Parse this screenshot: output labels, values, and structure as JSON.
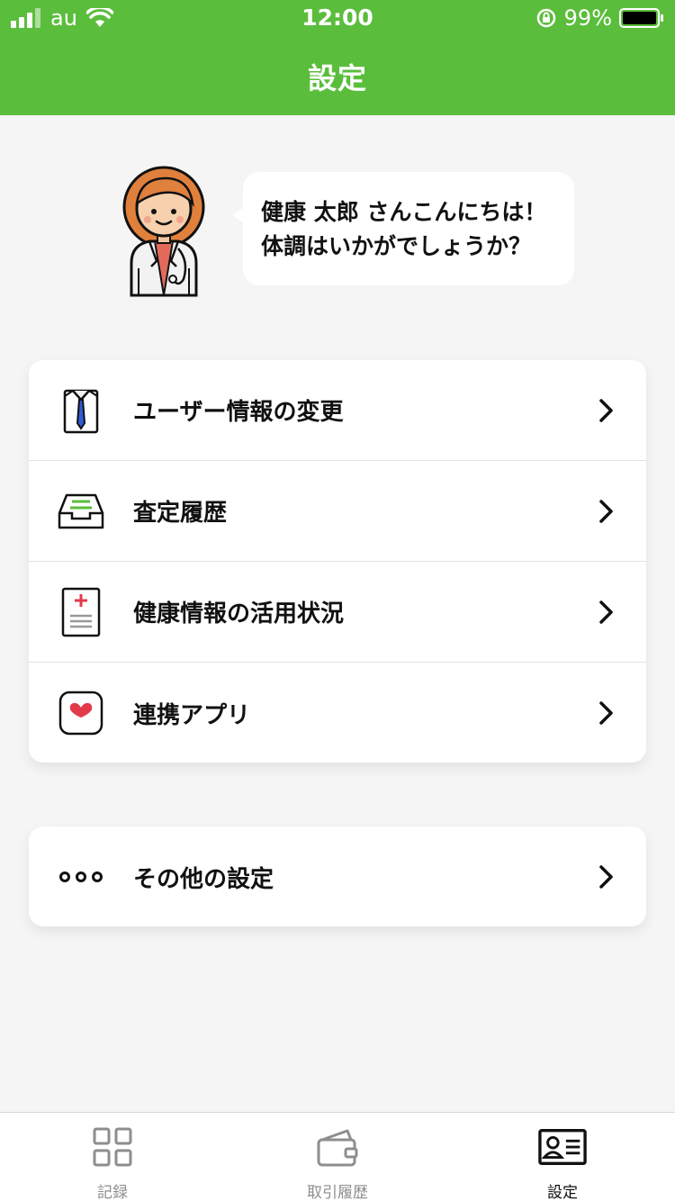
{
  "status_bar": {
    "carrier": "au",
    "time": "12:00",
    "battery": "99%"
  },
  "header": {
    "title": "設定"
  },
  "greeting": {
    "line1": "健康 太郎 さんこんにちは！",
    "line2": "体調はいかがでしょうか？"
  },
  "menu": {
    "items": [
      {
        "label": "ユーザー情報の変更",
        "icon": "shirt-tie-icon"
      },
      {
        "label": "査定履歴",
        "icon": "inbox-tray-icon"
      },
      {
        "label": "健康情報の活用状況",
        "icon": "medical-record-icon"
      },
      {
        "label": "連携アプリ",
        "icon": "heart-app-icon"
      }
    ]
  },
  "other": {
    "label": "その他の設定",
    "icon": "more-dots-icon"
  },
  "tabbar": {
    "tabs": [
      {
        "label": "記録",
        "icon": "grid-icon",
        "active": false
      },
      {
        "label": "取引履歴",
        "icon": "wallet-icon",
        "active": false
      },
      {
        "label": "設定",
        "icon": "id-card-icon",
        "active": true
      }
    ]
  },
  "colors": {
    "accent": "#5bbd3c",
    "background": "#f5f5f5",
    "heart": "#e23a4b"
  }
}
